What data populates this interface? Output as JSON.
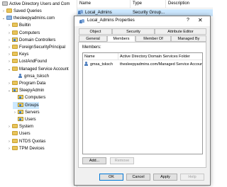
{
  "tree": {
    "root_label": "Active Directory Users and Com",
    "items": [
      {
        "label": "Saved Queries",
        "indent": 0,
        "chevron": "›",
        "icon": "folder"
      },
      {
        "label": "thesleepyadmins.com",
        "indent": 0,
        "chevron": "⌄",
        "icon": "domain"
      },
      {
        "label": "Builtin",
        "indent": 1,
        "chevron": "›",
        "icon": "folder"
      },
      {
        "label": "Computers",
        "indent": 1,
        "chevron": "›",
        "icon": "folder"
      },
      {
        "label": "Domain Controllers",
        "indent": 1,
        "chevron": "›",
        "icon": "ou"
      },
      {
        "label": "ForeignSecurityPrincipal",
        "indent": 1,
        "chevron": "›",
        "icon": "folder"
      },
      {
        "label": "Keys",
        "indent": 1,
        "chevron": "›",
        "icon": "folder"
      },
      {
        "label": "LostAndFound",
        "indent": 1,
        "chevron": "›",
        "icon": "folder"
      },
      {
        "label": "Managed Service Account",
        "indent": 1,
        "chevron": "⌄",
        "icon": "folder"
      },
      {
        "label": "gmsa_tsksch",
        "indent": 2,
        "chevron": "",
        "icon": "user"
      },
      {
        "label": "Program Data",
        "indent": 1,
        "chevron": "›",
        "icon": "folder"
      },
      {
        "label": "SleepyAdmin",
        "indent": 1,
        "chevron": "⌄",
        "icon": "ou"
      },
      {
        "label": "Computers",
        "indent": 2,
        "chevron": "",
        "icon": "ou"
      },
      {
        "label": "Groups",
        "indent": 2,
        "chevron": "",
        "icon": "ou",
        "selected": true
      },
      {
        "label": "Servers",
        "indent": 2,
        "chevron": "›",
        "icon": "ou"
      },
      {
        "label": "Users",
        "indent": 2,
        "chevron": "",
        "icon": "ou"
      },
      {
        "label": "System",
        "indent": 1,
        "chevron": "›",
        "icon": "folder"
      },
      {
        "label": "Users",
        "indent": 1,
        "chevron": "",
        "icon": "folder"
      },
      {
        "label": "NTDS Quotas",
        "indent": 1,
        "chevron": "›",
        "icon": "folder"
      },
      {
        "label": "TPM Devices",
        "indent": 1,
        "chevron": "›",
        "icon": "folder"
      }
    ]
  },
  "list": {
    "columns": [
      "Name",
      "Type",
      "Description"
    ],
    "rows": [
      {
        "name": "Local_Admins",
        "type": "Security Group..."
      }
    ]
  },
  "dialog": {
    "title": "Local_Admins Properties",
    "help": "?",
    "close": "✕",
    "tabs_row1": [
      "Object",
      "Security",
      "Attribute Editor"
    ],
    "tabs_row2": [
      "General",
      "Members",
      "Member Of",
      "Managed By"
    ],
    "active_tab": "Members",
    "members_label": "Members:",
    "member_columns": [
      "Name",
      "Active Directory Domain Services Folder"
    ],
    "members": [
      {
        "name": "gmsa_tsksch",
        "folder": "thesleepyadmins.com/Managed Service Accounts"
      }
    ],
    "add_button": "Add...",
    "remove_button": "Remove",
    "ok_button": "OK",
    "cancel_button": "Cancel",
    "apply_button": "Apply",
    "help_button": "Help"
  },
  "colors": {
    "selection": "#cce8ff",
    "dialog_bg": "#f0f0f0",
    "accent": "#0078d7"
  }
}
